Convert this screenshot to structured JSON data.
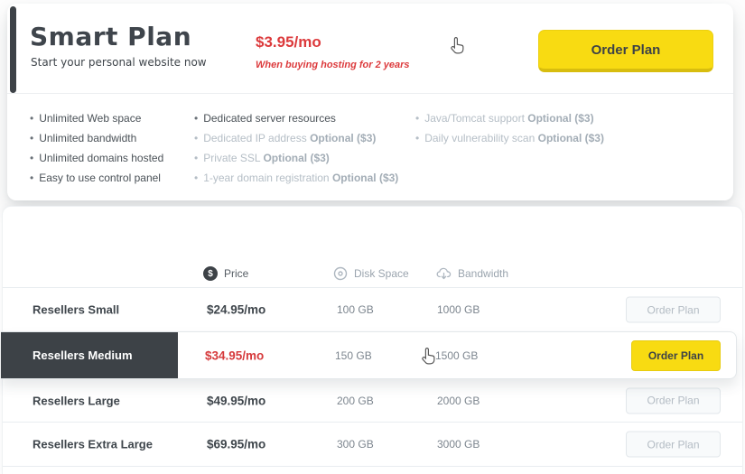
{
  "colors": {
    "accent_yellow": "#f8db12",
    "dark_charcoal": "#3d4247",
    "price_red": "#dc3a3c",
    "muted_text": "#aab4bd"
  },
  "plan_card": {
    "title": "Smart Plan",
    "subtitle": "Start your personal website now",
    "price": "$3.95/mo",
    "price_note": "When buying hosting for 2 years",
    "order_button_label": "Order Plan",
    "features": {
      "col1": [
        {
          "label": "Unlimited Web space"
        },
        {
          "label": "Unlimited bandwidth"
        },
        {
          "label": "Unlimited domains hosted"
        },
        {
          "label": "Easy to use control panel"
        }
      ],
      "col2": [
        {
          "label": "Dedicated server resources"
        },
        {
          "label": "Dedicated IP address",
          "optional": "Optional ($3)"
        },
        {
          "label": "Private SSL",
          "optional": "Optional ($3)"
        },
        {
          "label": "1-year domain registration",
          "optional": "Optional ($3)"
        }
      ],
      "col3": [
        {
          "label": "Java/Tomcat support",
          "optional": "Optional ($3)"
        },
        {
          "label": "Daily vulnerability scan",
          "optional": "Optional ($3)"
        }
      ]
    }
  },
  "table": {
    "headers": {
      "price": {
        "label": "Price",
        "icon": "dollar-circle-icon"
      },
      "disk": {
        "label": "Disk Space",
        "icon": "disc-icon"
      },
      "bandwidth": {
        "label": "Bandwidth",
        "icon": "cloud-download-icon"
      }
    },
    "rows": [
      {
        "name": "Resellers Small",
        "price": "$24.95/mo",
        "disk": "100 GB",
        "bandwidth": "1000 GB",
        "button": "Order Plan",
        "highlighted": false
      },
      {
        "name": "Resellers Medium",
        "price": "$34.95/mo",
        "disk": "150 GB",
        "bandwidth": "1500 GB",
        "button": "Order Plan",
        "highlighted": true
      },
      {
        "name": "Resellers Large",
        "price": "$49.95/mo",
        "disk": "200 GB",
        "bandwidth": "2000 GB",
        "button": "Order Plan",
        "highlighted": false
      },
      {
        "name": "Resellers Extra Large",
        "price": "$69.95/mo",
        "disk": "300 GB",
        "bandwidth": "3000 GB",
        "button": "Order Plan",
        "highlighted": false
      }
    ]
  }
}
